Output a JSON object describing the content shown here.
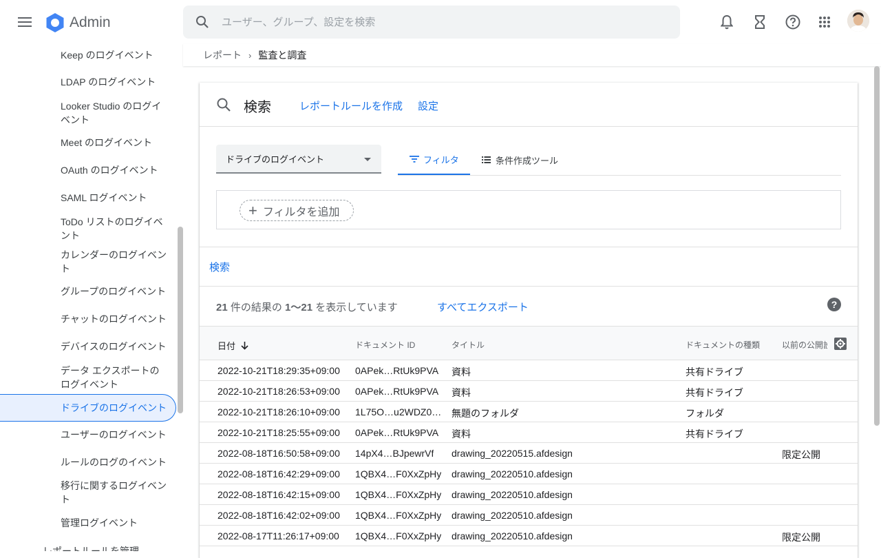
{
  "app": {
    "name": "Admin"
  },
  "search": {
    "placeholder": "ユーザー、グループ、設定を検索"
  },
  "breadcrumb": {
    "parent": "レポート",
    "current": "監査と調査"
  },
  "sidebar": {
    "items": [
      {
        "label": "Keep のログイベント"
      },
      {
        "label": "LDAP のログイベント"
      },
      {
        "label": "Looker Studio のログイベント"
      },
      {
        "label": "Meet のログイベント"
      },
      {
        "label": "OAuth のログイベント"
      },
      {
        "label": "SAML ログイベント"
      },
      {
        "label": "ToDo リストのログイベント"
      },
      {
        "label": "カレンダーのログイベント"
      },
      {
        "label": "グループのログイベント"
      },
      {
        "label": "チャットのログイベント"
      },
      {
        "label": "デバイスのログイベント"
      },
      {
        "label": "データ エクスポートのログイベント"
      },
      {
        "label": "ドライブのログイベント",
        "active": true
      },
      {
        "label": "ユーザーのログイベント"
      },
      {
        "label": "ルールのログのイベント"
      },
      {
        "label": "移行に関するログイベント"
      },
      {
        "label": "管理ログイベント"
      }
    ],
    "manage_label": "レポートルールを管理"
  },
  "card": {
    "title": "検索",
    "create_rule_link": "レポートルールを作成",
    "settings_link": "設定"
  },
  "data_source": {
    "selected": "ドライブのログイベント"
  },
  "tabs": [
    {
      "label": "フィルタ",
      "active": true
    },
    {
      "label": "条件作成ツール",
      "active": false
    }
  ],
  "filter": {
    "add_label": "フィルタを追加"
  },
  "search_button": "検索",
  "results": {
    "total": "21",
    "range": "1〜21",
    "prefix": " 件の結果の ",
    "suffix": " を表示しています",
    "export_label": "すべてエクスポート"
  },
  "table": {
    "columns": [
      "日付",
      "ドキュメント ID",
      "タイトル",
      "ドキュメントの種類",
      "以前の公開設定"
    ],
    "rows": [
      [
        "2022-10-21T18:29:35+09:00",
        "0APek…RtUk9PVA",
        "資料",
        "共有ドライブ",
        ""
      ],
      [
        "2022-10-21T18:26:53+09:00",
        "0APek…RtUk9PVA",
        "資料",
        "共有ドライブ",
        ""
      ],
      [
        "2022-10-21T18:26:10+09:00",
        "1L75O…u2WDZ0…",
        "無題のフォルダ",
        "フォルダ",
        ""
      ],
      [
        "2022-10-21T18:25:55+09:00",
        "0APek…RtUk9PVA",
        "資料",
        "共有ドライブ",
        ""
      ],
      [
        "2022-08-18T16:50:58+09:00",
        "14pX4…BJpewrVf",
        "drawing_20220515.afdesign",
        "",
        "限定公開"
      ],
      [
        "2022-08-18T16:42:29+09:00",
        "1QBX4…F0XxZpHy",
        "drawing_20220510.afdesign",
        "",
        ""
      ],
      [
        "2022-08-18T16:42:15+09:00",
        "1QBX4…F0XxZpHy",
        "drawing_20220510.afdesign",
        "",
        ""
      ],
      [
        "2022-08-18T16:42:02+09:00",
        "1QBX4…F0XxZpHy",
        "drawing_20220510.afdesign",
        "",
        ""
      ],
      [
        "2022-08-17T11:26:17+09:00",
        "1QBX4…F0XxZpHy",
        "drawing_20220510.afdesign",
        "",
        "限定公開"
      ]
    ]
  },
  "colors": {
    "accent": "#1a73e8",
    "logo": "#4285f4"
  },
  "icons": [
    "menu-icon",
    "admin-logo-icon",
    "search-icon",
    "bell-icon",
    "hourglass-icon",
    "help-icon",
    "apps-grid-icon",
    "filter-icon",
    "list-icon",
    "plus-icon",
    "arrow-down-icon",
    "gear-icon"
  ]
}
